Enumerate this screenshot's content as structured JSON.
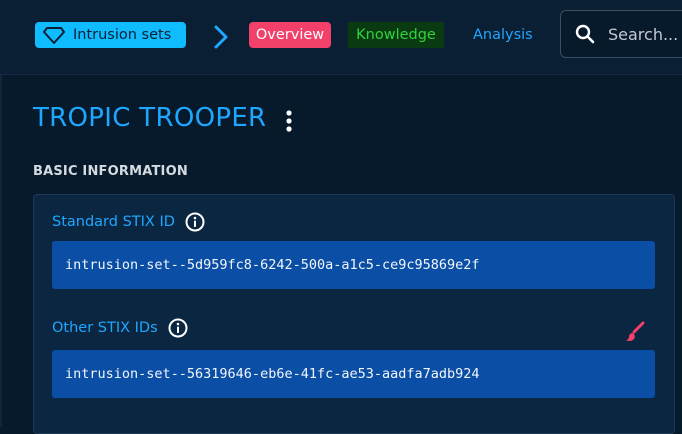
{
  "header": {
    "entity_type": "Intrusion sets",
    "tabs": [
      {
        "label": "Overview",
        "active": true
      },
      {
        "label": "Knowledge"
      },
      {
        "label": "Analysis"
      }
    ],
    "search_placeholder": "Search..."
  },
  "entity": {
    "name": "TROPIC TROOPER"
  },
  "basic_information": {
    "section_title": "BASIC INFORMATION",
    "standard_stix_id_label": "Standard STIX ID",
    "standard_stix_id": "intrusion-set--5d959fc8-6242-500a-a1c5-ce9c95869e2f",
    "other_stix_ids_label": "Other STIX IDs",
    "other_stix_ids": [
      "intrusion-set--56319646-eb6e-41fc-ae53-aadfa7adb924"
    ]
  },
  "colors": {
    "accent": "#1ea7ff",
    "active_tab": "#f3406b",
    "chip": "#0fbcff",
    "id_box": "#0a4ea6",
    "background": "#071a2c"
  },
  "icons": [
    "diamond-icon",
    "chevron-right-icon",
    "search-icon",
    "kebab-menu-icon",
    "info-icon",
    "brush-icon"
  ]
}
